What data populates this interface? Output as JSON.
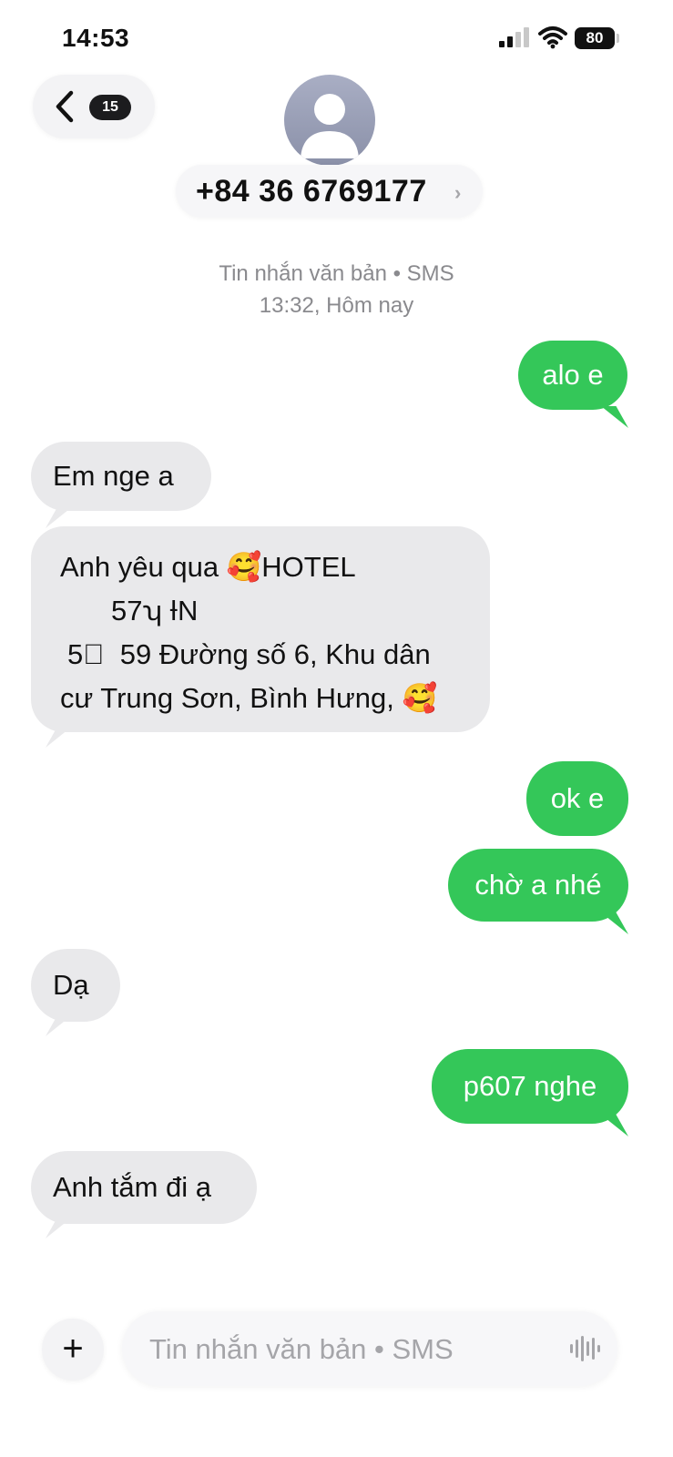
{
  "status_bar": {
    "time": "14:53",
    "battery": "80"
  },
  "header": {
    "back_badge": "15",
    "contact": "+84 36 6769177",
    "chevron": "›"
  },
  "thread": {
    "meta_label": "Tin nhắn văn bản • SMS",
    "meta_time": "13:32, Hôm nay"
  },
  "messages": [
    {
      "direction": "outgoing",
      "text": "alo e"
    },
    {
      "direction": "incoming",
      "text": "Em nge a"
    },
    {
      "direction": "incoming",
      "lines": [
        "Anh yêu qua 🥰HOTEL",
        "57ʮ ƗN",
        "5ﾞ ⁠ 59 Đường số 6, Khu dân",
        "cư Trung Sơn, Bình Hưng, 🥰"
      ]
    },
    {
      "direction": "outgoing",
      "text": "ok e"
    },
    {
      "direction": "outgoing",
      "text": "chờ a nhé"
    },
    {
      "direction": "incoming",
      "text": "Dạ"
    },
    {
      "direction": "outgoing",
      "text": "p607 nghe"
    },
    {
      "direction": "incoming",
      "text": "Anh tắm đi ạ"
    }
  ],
  "composer": {
    "plus": "+",
    "placeholder": "Tin nhắn văn bản • SMS"
  },
  "icons": {
    "back": "chevron-left-icon",
    "avatar": "person-silhouette-icon",
    "signal": "cellular-signal-icon",
    "wifi": "wifi-icon",
    "waveform": "waveform-icon"
  },
  "colors": {
    "outgoing_bubble": "#34c759",
    "incoming_bubble": "#e9e9eb",
    "meta_text": "#8a8a8e"
  }
}
